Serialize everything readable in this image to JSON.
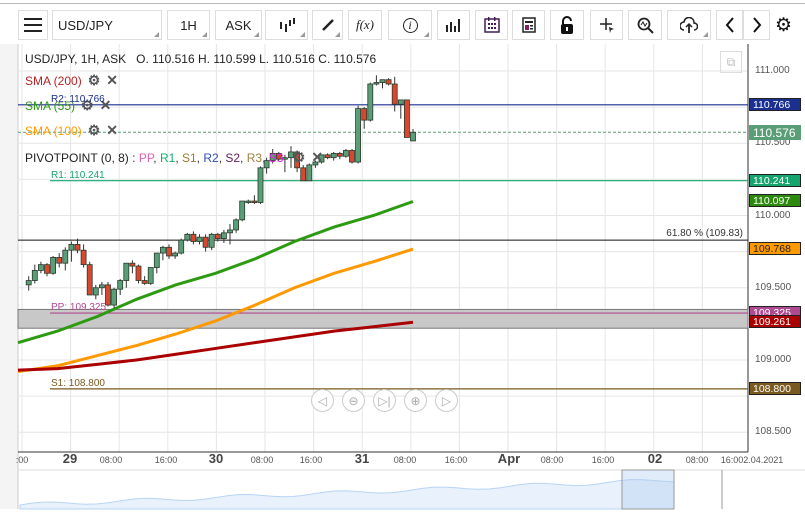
{
  "toolbar": {
    "menu": "menu-icon",
    "symbol": "USD/JPY",
    "interval": "1H",
    "price_type": "ASK",
    "fx_label": "f(x)",
    "info_label": "i"
  },
  "header": {
    "ohlc": "USD/JPY, 1H, ASK   O. 110.516 H. 110.599 L. 110.516 C. 110.576"
  },
  "indicators": [
    {
      "label": "SMA (200)",
      "color": "#b22222"
    },
    {
      "label": "SMA (55)",
      "color": "#2e9a12"
    },
    {
      "label": "SMA (100)",
      "color": "#ff9900"
    }
  ],
  "pivot": {
    "label": "PIVOTPOINT (0, 8)",
    "sep": " : ",
    "items": [
      {
        "t": "PP",
        "c": "#e060b0"
      },
      {
        "t": "R1",
        "c": "#10b070"
      },
      {
        "t": "S1",
        "c": "#9a7a30"
      },
      {
        "t": "R2",
        "c": "#3050b0"
      },
      {
        "t": "S2",
        "c": "#602060"
      },
      {
        "t": "R3",
        "c": "#a08040"
      },
      {
        "t": "S3",
        "c": "#e020e0"
      }
    ]
  },
  "levels": [
    {
      "name": "R2",
      "label": "R2: 110.766",
      "value": 110.766,
      "color": "#1a2f8f",
      "tag": "110.766"
    },
    {
      "name": "R1",
      "label": "R1: 110.241",
      "value": 110.241,
      "color": "#16a56e",
      "tag": "110.241"
    },
    {
      "name": "PP",
      "label": "PP: 109.325",
      "value": 109.325,
      "color": "#b04a90",
      "tag": "109.325"
    },
    {
      "name": "S1",
      "label": "S1: 108.800",
      "value": 108.8,
      "color": "#7a5a1e",
      "tag": "108.800"
    }
  ],
  "fib": {
    "label": "61.80 % (109.83)",
    "value": 109.83
  },
  "band": [
    109.22,
    109.35
  ],
  "last_price": {
    "value": 110.576,
    "tag": "110.576",
    "color": "#5a9e78"
  },
  "sma_tags": [
    {
      "tag": "110.097",
      "value": 110.097,
      "color": "#2e8a0e"
    },
    {
      "tag": "109.768",
      "value": 109.768,
      "color": "#ff9900",
      "text": "#222"
    },
    {
      "tag": "109.261",
      "value": 109.261,
      "color": "#aa0000"
    }
  ],
  "price_axis": [
    "111.000",
    "110.500",
    "110.000",
    "109.500",
    "109.000",
    "108.500"
  ],
  "time_axis": [
    {
      "t": ":00",
      "day": false
    },
    {
      "t": "29",
      "day": true
    },
    {
      "t": "08:00",
      "day": false
    },
    {
      "t": "16:00",
      "day": false
    },
    {
      "t": "30",
      "day": true
    },
    {
      "t": "08:00",
      "day": false
    },
    {
      "t": "16:00",
      "day": false
    },
    {
      "t": "31",
      "day": true
    },
    {
      "t": "08:00",
      "day": false
    },
    {
      "t": "16:00",
      "day": false
    },
    {
      "t": "Apr",
      "day": true
    },
    {
      "t": "08:00",
      "day": false
    },
    {
      "t": "16:00",
      "day": false
    },
    {
      "t": "02",
      "day": true
    },
    {
      "t": "08:00",
      "day": false
    },
    {
      "t": "16:002.04.2021",
      "day": false
    }
  ],
  "chart_data": {
    "type": "candlestick",
    "symbol": "USD/JPY",
    "interval": "1H",
    "ylim": [
      108.4,
      111.18
    ],
    "colors": {
      "up": "#5a9e78",
      "down": "#d9472f"
    },
    "candles": [
      [
        109.52,
        109.58,
        109.48,
        109.55
      ],
      [
        109.55,
        109.66,
        109.53,
        109.62
      ],
      [
        109.62,
        109.68,
        109.6,
        109.66
      ],
      [
        109.66,
        109.67,
        109.58,
        109.6
      ],
      [
        109.6,
        109.72,
        109.59,
        109.71
      ],
      [
        109.71,
        109.74,
        109.64,
        109.67
      ],
      [
        109.67,
        109.78,
        109.62,
        109.76
      ],
      [
        109.76,
        109.82,
        109.68,
        109.8
      ],
      [
        109.8,
        109.84,
        109.74,
        109.76
      ],
      [
        109.76,
        109.8,
        109.64,
        109.66
      ],
      [
        109.66,
        109.68,
        109.45,
        109.45
      ],
      [
        109.45,
        109.52,
        109.42,
        109.5
      ],
      [
        109.5,
        109.54,
        109.45,
        109.52
      ],
      [
        109.52,
        109.54,
        109.37,
        109.38
      ],
      [
        109.38,
        109.5,
        109.36,
        109.49
      ],
      [
        109.49,
        109.56,
        109.45,
        109.55
      ],
      [
        109.55,
        109.67,
        109.5,
        109.67
      ],
      [
        109.67,
        109.69,
        109.6,
        109.65
      ],
      [
        109.65,
        109.66,
        109.53,
        109.55
      ],
      [
        109.55,
        109.58,
        109.52,
        109.53
      ],
      [
        109.53,
        109.64,
        109.52,
        109.64
      ],
      [
        109.64,
        109.74,
        109.6,
        109.74
      ],
      [
        109.74,
        109.79,
        109.69,
        109.78
      ],
      [
        109.78,
        109.8,
        109.7,
        109.72
      ],
      [
        109.72,
        109.75,
        109.7,
        109.74
      ],
      [
        109.74,
        109.84,
        109.73,
        109.83
      ],
      [
        109.83,
        109.88,
        109.82,
        109.87
      ],
      [
        109.87,
        109.89,
        109.8,
        109.82
      ],
      [
        109.82,
        109.87,
        109.8,
        109.85
      ],
      [
        109.85,
        109.87,
        109.75,
        109.78
      ],
      [
        109.78,
        109.88,
        109.76,
        109.87
      ],
      [
        109.87,
        109.88,
        109.82,
        109.84
      ],
      [
        109.84,
        109.9,
        109.81,
        109.88
      ],
      [
        109.88,
        109.94,
        109.8,
        109.9
      ],
      [
        109.9,
        109.98,
        109.88,
        109.97
      ],
      [
        109.97,
        110.1,
        109.96,
        110.1
      ],
      [
        110.1,
        110.11,
        110.08,
        110.1
      ],
      [
        110.1,
        110.14,
        110.08,
        110.09
      ],
      [
        110.09,
        110.34,
        110.08,
        110.33
      ],
      [
        110.33,
        110.4,
        110.29,
        110.38
      ],
      [
        110.38,
        110.46,
        110.36,
        110.43
      ],
      [
        110.43,
        110.44,
        110.38,
        110.39
      ],
      [
        110.39,
        110.42,
        110.3,
        110.4
      ],
      [
        110.4,
        110.48,
        110.33,
        110.44
      ],
      [
        110.44,
        110.45,
        110.3,
        110.33
      ],
      [
        110.33,
        110.35,
        110.24,
        110.24
      ],
      [
        110.24,
        110.36,
        110.24,
        110.35
      ],
      [
        110.35,
        110.38,
        110.33,
        110.37
      ],
      [
        110.37,
        110.42,
        110.36,
        110.42
      ],
      [
        110.42,
        110.43,
        110.39,
        110.4
      ],
      [
        110.4,
        110.44,
        110.38,
        110.43
      ],
      [
        110.43,
        110.44,
        110.39,
        110.41
      ],
      [
        110.41,
        110.46,
        110.4,
        110.45
      ],
      [
        110.45,
        110.46,
        110.36,
        110.37
      ],
      [
        110.37,
        110.76,
        110.36,
        110.74
      ],
      [
        110.74,
        110.75,
        110.6,
        110.66
      ],
      [
        110.66,
        110.92,
        110.65,
        110.91
      ],
      [
        110.91,
        110.97,
        110.9,
        110.92
      ],
      [
        110.92,
        110.94,
        110.88,
        110.94
      ],
      [
        110.94,
        110.95,
        110.9,
        110.91
      ],
      [
        110.91,
        110.96,
        110.72,
        110.77
      ],
      [
        110.77,
        110.8,
        110.67,
        110.8
      ],
      [
        110.8,
        110.8,
        110.54,
        110.54
      ],
      [
        110.516,
        110.599,
        110.516,
        110.576
      ]
    ],
    "sma": [
      {
        "name": "SMA (55)",
        "color": "#2e9a12",
        "values": [
          109.12,
          109.2,
          109.3,
          109.42,
          109.52,
          109.6,
          109.7,
          109.82,
          109.92,
          110.0,
          110.097
        ]
      },
      {
        "name": "SMA (100)",
        "color": "#ff9900",
        "values": [
          108.92,
          108.96,
          109.03,
          109.1,
          109.18,
          109.27,
          109.38,
          109.5,
          109.6,
          109.68,
          109.768
        ]
      },
      {
        "name": "SMA (200)",
        "color": "#aa0000",
        "values": [
          108.93,
          108.94,
          108.97,
          109.0,
          109.04,
          109.08,
          109.12,
          109.16,
          109.2,
          109.23,
          109.261
        ]
      }
    ]
  }
}
